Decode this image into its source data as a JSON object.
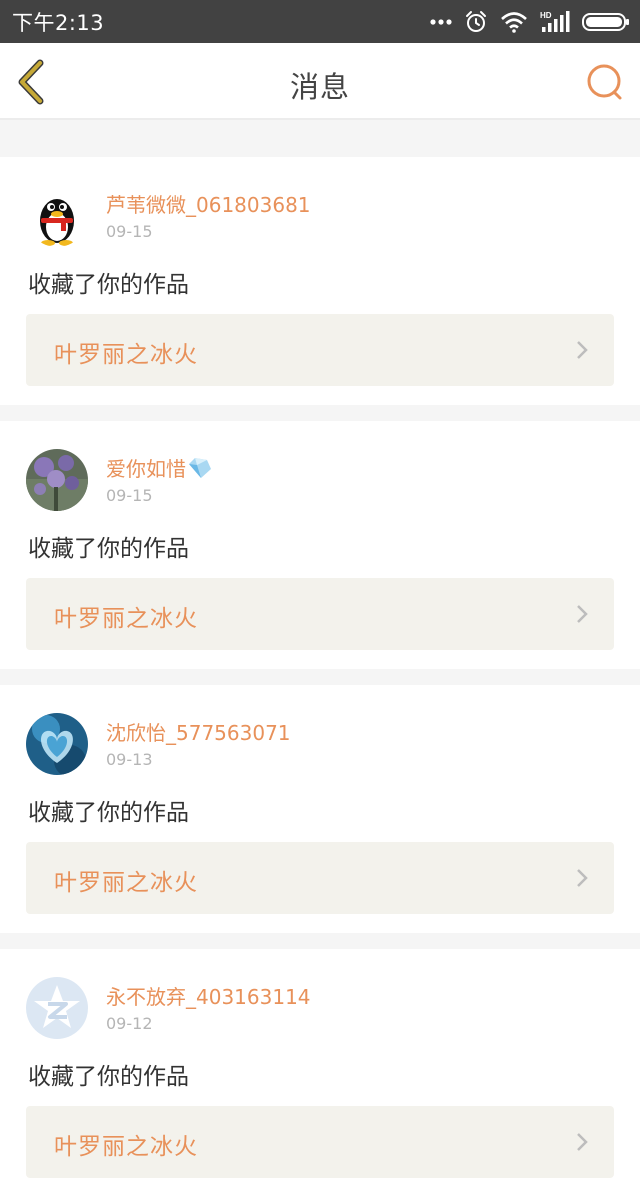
{
  "status_bar": {
    "time": "下午2:13",
    "icons": [
      "more-dots-icon",
      "alarm-icon",
      "wifi-icon",
      "hd-signal-icon",
      "battery-icon"
    ],
    "hd_label": "HD"
  },
  "nav": {
    "title": "消息",
    "back_icon": "chevron-left-icon",
    "search_icon": "search-icon",
    "accent_color": "#e8915a",
    "back_color": "#c6a937"
  },
  "messages": [
    {
      "username": "芦苇微微_061803681",
      "date": "09-15",
      "action": "收藏了你的作品",
      "work_title": "叶罗丽之冰火",
      "avatar": "qq-penguin-avatar"
    },
    {
      "username": "爱你如惜",
      "date": "09-15",
      "action": "收藏了你的作品",
      "work_title": "叶罗丽之冰火",
      "avatar": "purple-flower-avatar"
    },
    {
      "username": "沈欣怡_577563071",
      "date": "09-13",
      "action": "收藏了你的作品",
      "work_title": "叶罗丽之冰火",
      "avatar": "blue-heart-avatar"
    },
    {
      "username": "永不放弃_403163114",
      "date": "09-12",
      "action": "收藏了你的作品",
      "work_title": "叶罗丽之冰火",
      "avatar": "qzone-star-avatar"
    }
  ]
}
